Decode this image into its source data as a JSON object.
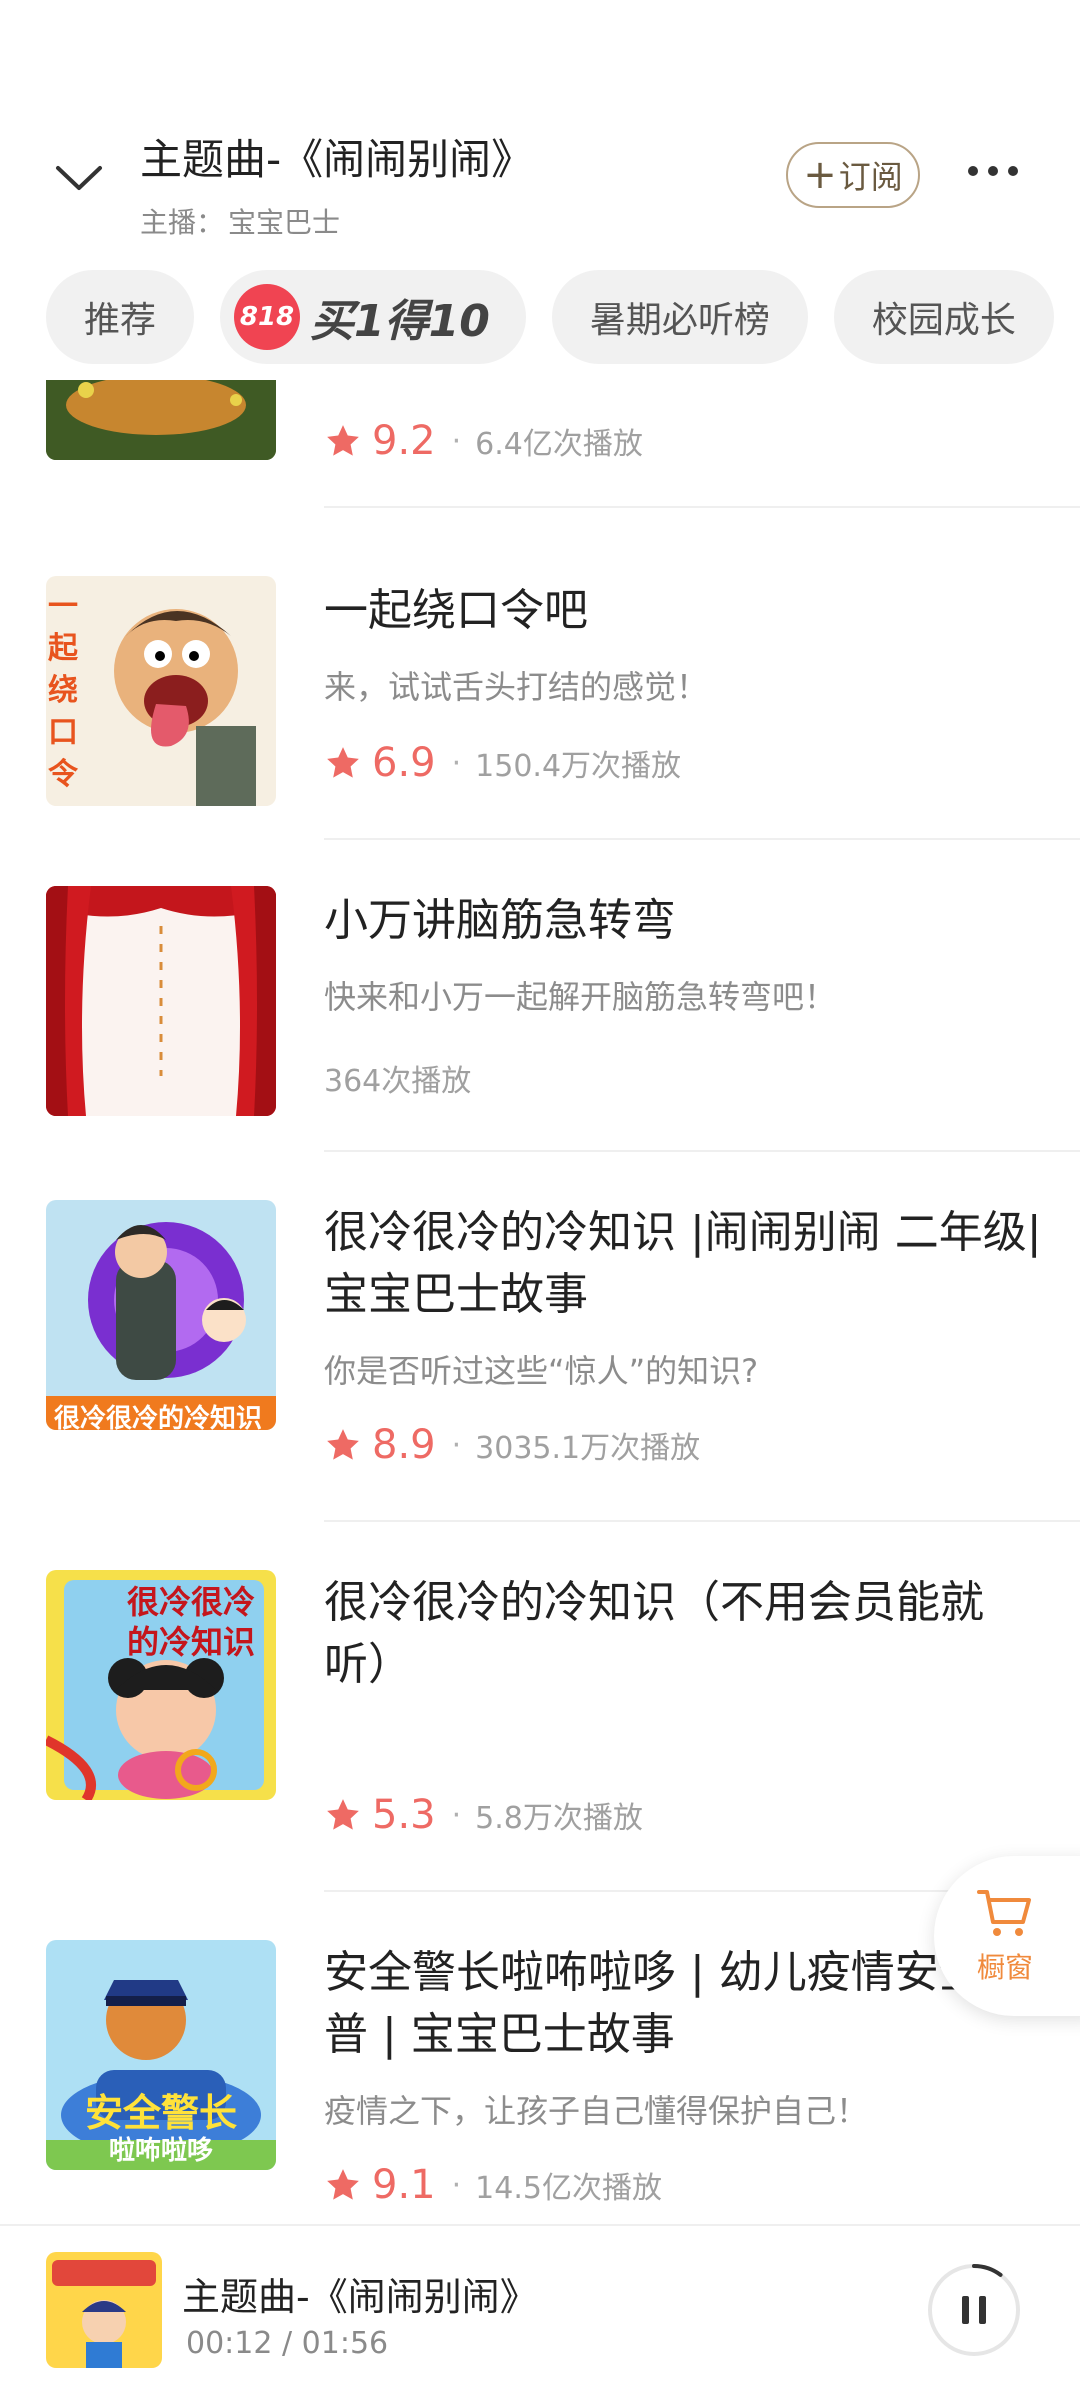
{
  "header": {
    "title": "主题曲-《闹闹别闹》",
    "host_label": "主播：",
    "host_name": "宝宝巴士",
    "subscribe_label": "订阅"
  },
  "tabs": [
    {
      "label": "推荐"
    },
    {
      "label": "买1得10",
      "badge": "818"
    },
    {
      "label": "暑期必听榜"
    },
    {
      "label": "校园成长"
    }
  ],
  "items": [
    {
      "title": "",
      "desc": "",
      "rating": "9.2",
      "plays": "6.4亿次播放"
    },
    {
      "title": "一起绕口令吧",
      "desc": "来，试试舌头打结的感觉！",
      "rating": "6.9",
      "plays": "150.4万次播放"
    },
    {
      "title": "小万讲脑筋急转弯",
      "desc": "快来和小万一起解开脑筋急转弯吧！",
      "rating": "",
      "plays": "364次播放"
    },
    {
      "title": "很冷很冷的冷知识 |闹闹别闹 二年级|宝宝巴士故事",
      "desc": "你是否听过这些“惊人”的知识?",
      "rating": "8.9",
      "plays": "3035.1万次播放"
    },
    {
      "title": "很冷很冷的冷知识（不用会员能就听）",
      "desc": "",
      "rating": "5.3",
      "plays": "5.8万次播放"
    },
    {
      "title": "安全警长啦咘啦哆 | 幼儿疫情安全科普 | 宝宝巴士故事",
      "desc": "疫情之下，让孩子自己懂得保护自己！",
      "rating": "9.1",
      "plays": "14.5亿次播放"
    }
  ],
  "covers": {
    "tongue_twister_text": "一起绕口令",
    "cold_facts_banner": "很冷很冷的冷知识",
    "cold_facts_2_text": "很冷很冷的冷知识",
    "safety_title": "安全警长",
    "safety_subtitle": "啦咘啦哆"
  },
  "cart": {
    "label": "橱窗"
  },
  "player": {
    "title": "主题曲-《闹闹别闹》",
    "elapsed": "00:12",
    "duration": "01:56",
    "progress": 0.103
  },
  "colors": {
    "accent_star": "#ee6a64",
    "cart_orange": "#f08a3c",
    "promo_red": "#f04452",
    "subscribe_border": "#b9a486"
  }
}
